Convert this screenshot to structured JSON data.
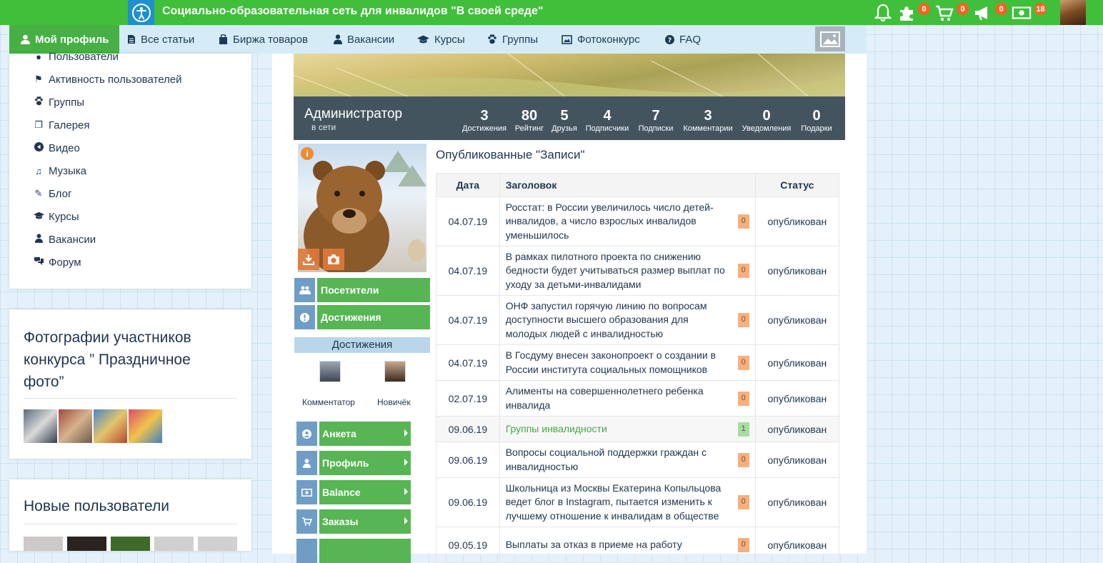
{
  "header": {
    "title": "Социально-образовательная сеть для инвалидов \"В своей среде\"",
    "badges": {
      "puzzle": "0",
      "cart": "0",
      "megaphone": "0",
      "money": "18"
    }
  },
  "nav": {
    "items": [
      {
        "label": "Мой профиль",
        "icon": "user-icon"
      },
      {
        "label": "Все статьи",
        "icon": "document-icon"
      },
      {
        "label": "Биржа товаров",
        "icon": "shopping-bag-icon"
      },
      {
        "label": "Вакансии",
        "icon": "user-tie-icon"
      },
      {
        "label": "Курсы",
        "icon": "graduation-cap-icon"
      },
      {
        "label": "Группы",
        "icon": "paw-icon"
      },
      {
        "label": "Фотоконкурс",
        "icon": "photo-icon"
      },
      {
        "label": "FAQ",
        "icon": "question-icon"
      }
    ]
  },
  "sidebar": {
    "items": [
      {
        "label": "Пользователи",
        "icon": "users-icon"
      },
      {
        "label": "Активность пользователей",
        "icon": "flag-icon"
      },
      {
        "label": "Группы",
        "icon": "paw-icon"
      },
      {
        "label": "Галерея",
        "icon": "gallery-icon"
      },
      {
        "label": "Видео",
        "icon": "play-icon"
      },
      {
        "label": "Музыка",
        "icon": "music-icon"
      },
      {
        "label": "Блог",
        "icon": "pencil-icon"
      },
      {
        "label": "Курсы",
        "icon": "graduation-cap-icon"
      },
      {
        "label": "Вакансии",
        "icon": "user-tie-icon"
      },
      {
        "label": "Форум",
        "icon": "comments-icon"
      }
    ]
  },
  "contest": {
    "title": "Фотографии участников конкурса ” Праздничное фото”"
  },
  "new_users": {
    "title": "Новые пользователи"
  },
  "profile": {
    "name": "Администратор",
    "status": "в сети",
    "stats": [
      {
        "num": "3",
        "label": "Достижения"
      },
      {
        "num": "80",
        "label": "Рейтинг"
      },
      {
        "num": "5",
        "label": "Друзья"
      },
      {
        "num": "4",
        "label": "Подписчики"
      },
      {
        "num": "7",
        "label": "Подписки"
      },
      {
        "num": "3",
        "label": "Комментарии"
      },
      {
        "num": "0",
        "label": "Уведомления"
      },
      {
        "num": "0",
        "label": "Подарки"
      }
    ],
    "buttons": [
      {
        "label": "Посетители",
        "icon": "users-icon"
      },
      {
        "label": "Достижения",
        "icon": "exclamation-icon"
      }
    ],
    "achievements_title": "Достижения",
    "achievements": [
      {
        "label": "Комментатор"
      },
      {
        "label": "Новичёк"
      }
    ],
    "menu": [
      {
        "label": "Анкета",
        "icon": "user-circle-icon"
      },
      {
        "label": "Профиль",
        "icon": "user-icon"
      },
      {
        "label": "Balance",
        "icon": "money-icon"
      },
      {
        "label": "Заказы",
        "icon": "cart-icon"
      }
    ]
  },
  "posts": {
    "title": "Опубликованные \"Записи\"",
    "headers": {
      "date": "Дата",
      "title": "Заголовок",
      "status": "Статус"
    },
    "rows": [
      {
        "date": "04.07.19",
        "title": "Росстат: в России увеличилось число детей-инвалидов, а число взрослых инвалидов уменьшилось",
        "count": "0",
        "status": "опубликован"
      },
      {
        "date": "04.07.19",
        "title": "В рамках пилотного проекта по снижению бедности будет учитываться размер выплат по уходу за детьми-инвалидами",
        "count": "0",
        "status": "опубликован"
      },
      {
        "date": "04.07.19",
        "title": "ОНФ запустил горячую линию по вопросам доступности высшего образования для молодых людей с инвалидностью",
        "count": "0",
        "status": "опубликован"
      },
      {
        "date": "04.07.19",
        "title": "В Госдуму внесен законопроект о создании в России института социальных помощников",
        "count": "0",
        "status": "опубликован"
      },
      {
        "date": "02.07.19",
        "title": "Алименты на совершеннолетнего ребенка инвалида",
        "count": "0",
        "status": "опубликован"
      },
      {
        "date": "09.06.19",
        "title": "Группы инвалидности",
        "count": "1",
        "status": "опубликован"
      },
      {
        "date": "09.06.19",
        "title": "Вопросы социальной поддержки граждан с инвалидностью",
        "count": "0",
        "status": "опубликован"
      },
      {
        "date": "09.06.19",
        "title": "Школьница из Москвы Екатерина Копыльцова ведет блог в Instagram, пытается изменить к лучшему отношение к инвалидам в обществе",
        "count": "0",
        "status": "опубликован"
      },
      {
        "date": "09.05.19",
        "title": "Выплаты за отказ в приеме на работу",
        "count": "0",
        "status": "опубликован"
      }
    ]
  }
}
